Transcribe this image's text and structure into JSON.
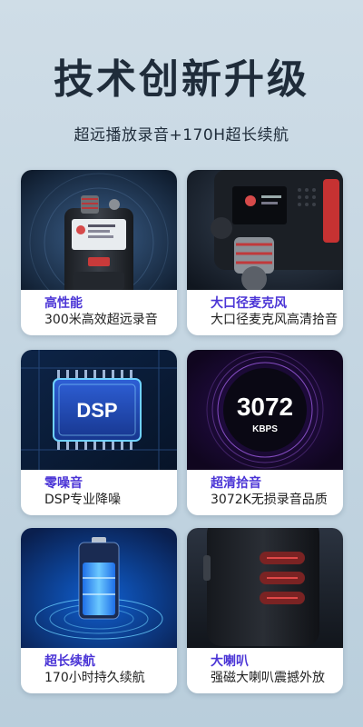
{
  "header": {
    "title": "技术创新升级",
    "subtitle": "超远播放录音+170H超长续航"
  },
  "cards": [
    {
      "title": "高性能",
      "desc": "300米高效超远录音",
      "image": "recorder-front-image"
    },
    {
      "title": "大口径麦克风",
      "desc": "大口径麦克风高清拾音",
      "image": "microphone-closeup-image"
    },
    {
      "title": "零噪音",
      "desc": "DSP专业降噪",
      "image": "dsp-chip-image",
      "image_text": "DSP"
    },
    {
      "title": "超清拾音",
      "desc": "3072K无损录音品质",
      "image": "bitrate-badge-image",
      "image_text": "3072",
      "image_subtext": "KBPS"
    },
    {
      "title": "超长续航",
      "desc": "170小时持久续航",
      "image": "battery-image"
    },
    {
      "title": "大喇叭",
      "desc": "强磁大喇叭震撼外放",
      "image": "speaker-grille-image"
    }
  ],
  "colors": {
    "accent": "#4b35d6",
    "title": "#1f2c3a",
    "background": "#c4d6e2"
  }
}
